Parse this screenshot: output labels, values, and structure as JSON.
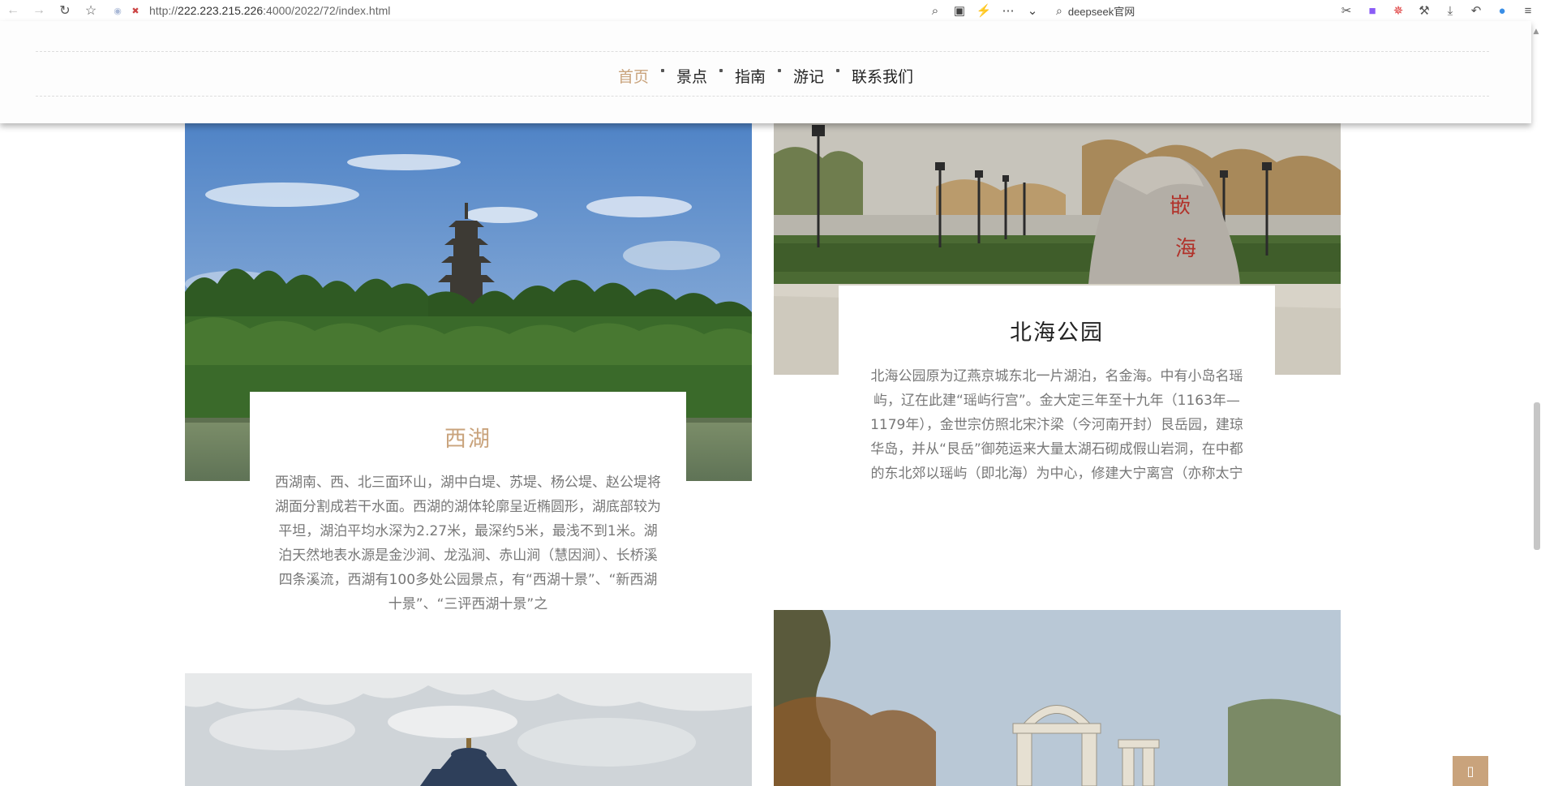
{
  "browser": {
    "url_prefix": "http://",
    "url_host": "222.223.215.226",
    "url_rest": ":4000/2022/72/index.html",
    "search_hint": "deepseek官网"
  },
  "nav": {
    "items": [
      {
        "label": "首页",
        "active": true
      },
      {
        "label": "景点",
        "active": false
      },
      {
        "label": "指南",
        "active": false
      },
      {
        "label": "游记",
        "active": false
      },
      {
        "label": "联系我们",
        "active": false
      }
    ]
  },
  "cards": {
    "xihu": {
      "title": "西湖",
      "desc": "西湖南、西、北三面环山，湖中白堤、苏堤、杨公堤、赵公堤将湖面分割成若干水面。西湖的湖体轮廓呈近椭圆形，湖底部较为平坦，湖泊平均水深为2.27米，最深约5米，最浅不到1米。湖泊天然地表水源是金沙涧、龙泓涧、赤山涧（慧因涧）、长桥溪四条溪流，西湖有100多处公园景点，有“西湖十景”、“新西湖十景”、“三评西湖十景”之"
    },
    "beihai": {
      "title": "北海公园",
      "desc": "北海公园原为辽燕京城东北一片湖泊，名金海。中有小岛名瑶屿，辽在此建“瑶屿行宫”。金大定三年至十九年（1163年—1179年），金世宗仿照北宋汴梁（今河南开封）艮岳园，建琼华岛，并从“艮岳”御苑运来大量太湖石砌成假山岩洞，在中都的东北郊以瑶屿（即北海）为中心，修建大宁离宫（亦称太宁宫）。从那时起，北海就基本形成了今天皇"
    }
  },
  "colors": {
    "accent": "#c9a37c",
    "text": "#222222",
    "muted": "#777777"
  },
  "icons": [
    "back-icon",
    "forward-icon",
    "reload-icon",
    "bookmark-star-icon",
    "site-info-icon",
    "insecure-icon",
    "zoom-icon",
    "image-icon",
    "bolt-icon",
    "more-icon",
    "chevron-down-icon",
    "search-icon",
    "cut-icon",
    "extension-icon",
    "puzzle-icon",
    "download-icon",
    "undo-icon",
    "profile-icon",
    "menu-icon",
    "back-to-top-icon"
  ]
}
